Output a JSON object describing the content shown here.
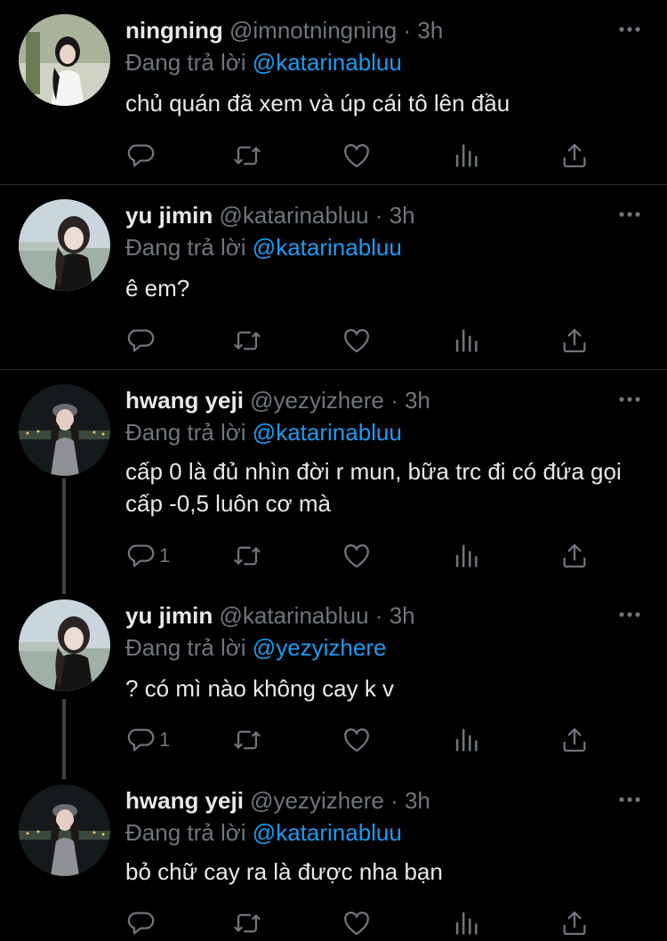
{
  "tweets": [
    {
      "name": "ningning",
      "handle": "@imnotningning",
      "dot": "·",
      "time": "3h",
      "reply_prefix": "Đang trả lời",
      "reply_to": "@katarinabluu",
      "text": "chủ quán đã xem và úp cái tô lên đầu",
      "reply_count": ""
    },
    {
      "name": "yu jimin",
      "handle": "@katarinabluu",
      "dot": "·",
      "time": "3h",
      "reply_prefix": "Đang trả lời",
      "reply_to": "@katarinabluu",
      "text": "ê em?",
      "reply_count": ""
    },
    {
      "name": "hwang yeji",
      "handle": "@yezyizhere",
      "dot": "·",
      "time": "3h",
      "reply_prefix": "Đang trả lời",
      "reply_to": "@katarinabluu",
      "text": "cấp 0 là đủ nhìn đời r mun, bữa trc đi có đứa gọi cấp -0,5 luôn cơ mà",
      "reply_count": "1"
    },
    {
      "name": "yu jimin",
      "handle": "@katarinabluu",
      "dot": "·",
      "time": "3h",
      "reply_prefix": "Đang trả lời",
      "reply_to": "@yezyizhere",
      "text": "? có mì nào không cay k v",
      "reply_count": "1"
    },
    {
      "name": "hwang yeji",
      "handle": "@yezyizhere",
      "dot": "·",
      "time": "3h",
      "reply_prefix": "Đang trả lời",
      "reply_to": "@katarinabluu",
      "text": "bỏ chữ cay ra là được nha bạn",
      "reply_count": ""
    }
  ],
  "icons": {
    "reply": "reply-icon",
    "retweet": "retweet-icon",
    "like": "heart-icon",
    "views": "views-icon",
    "share": "share-icon",
    "more": "more-icon"
  },
  "colors": {
    "background": "#000000",
    "text": "#e7e9ea",
    "muted": "#6e767d",
    "accent": "#1d9bf0",
    "separator": "#2f3336"
  }
}
